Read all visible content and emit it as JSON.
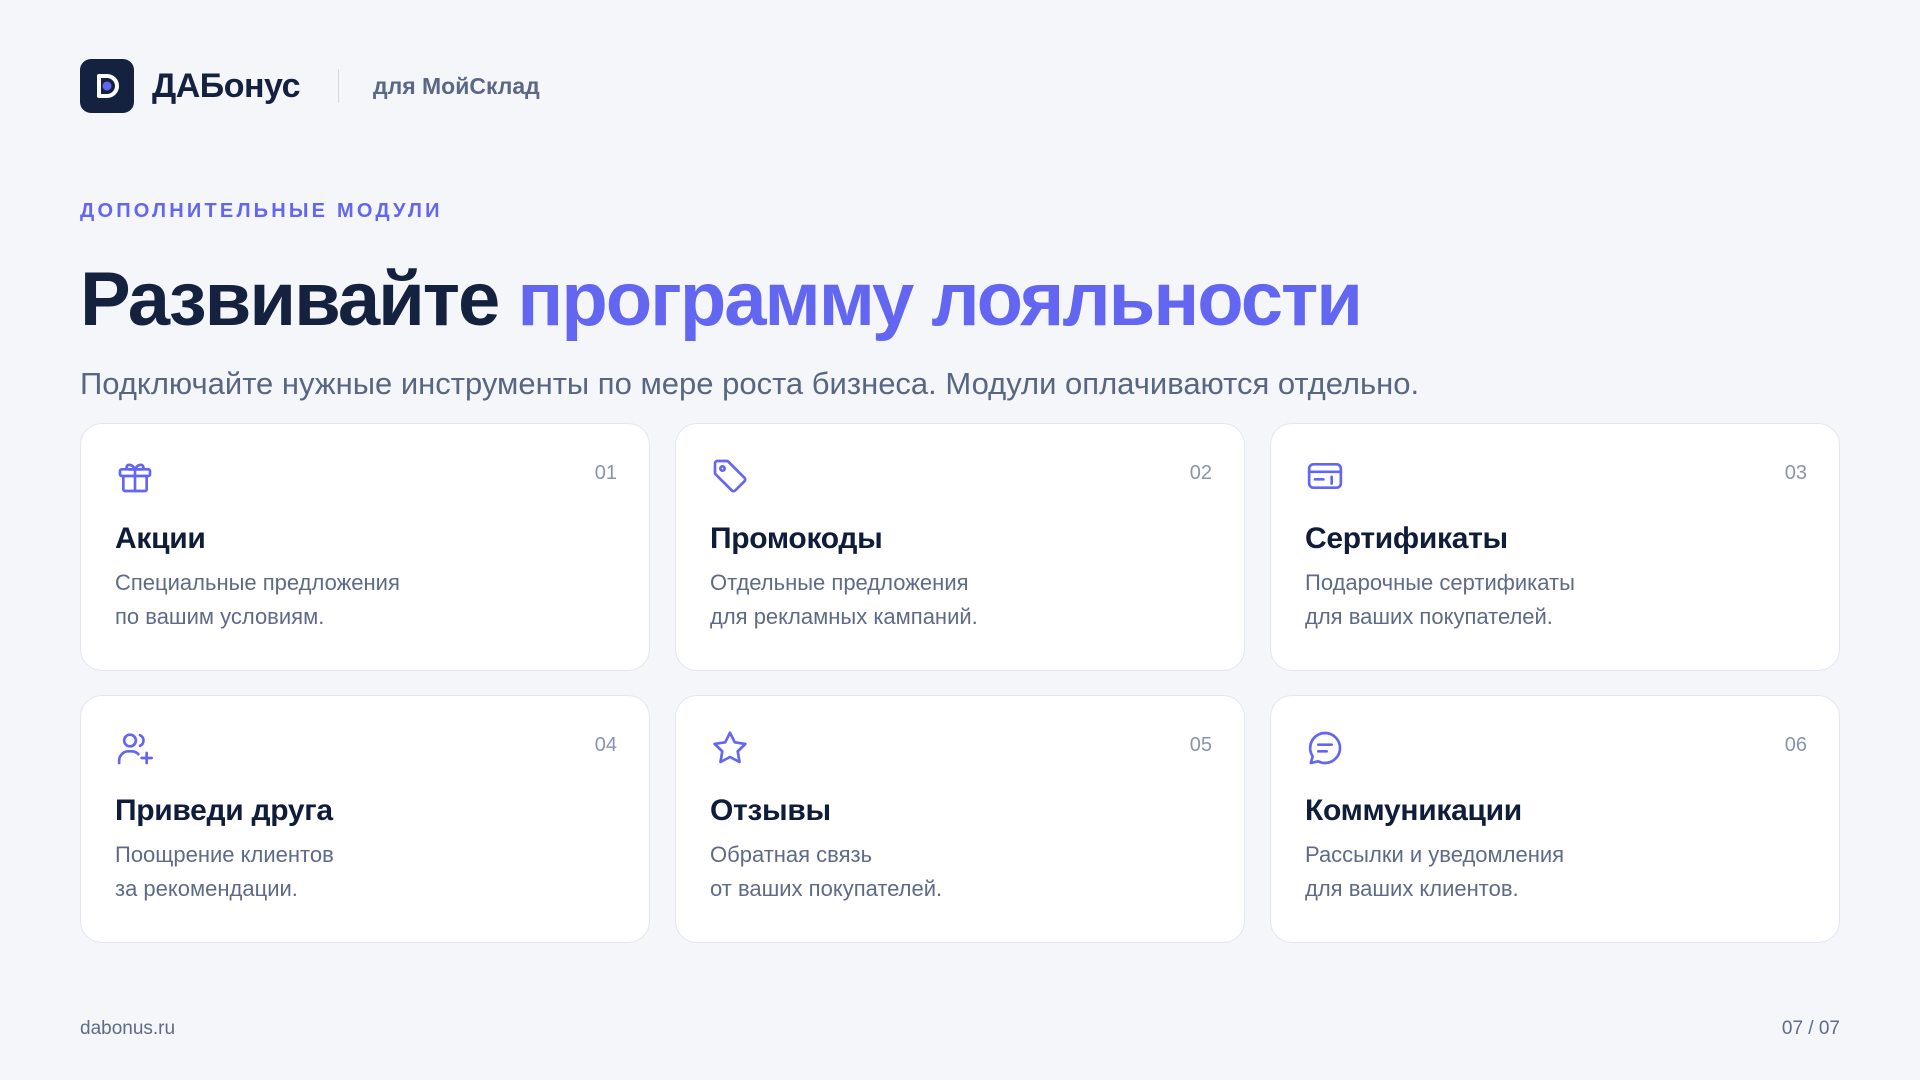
{
  "header": {
    "brand": "ДАБонус",
    "subtitle": "для МойСклад",
    "logo_icon": "dabonus-logo-icon"
  },
  "hero": {
    "eyebrow": "ДОПОЛНИТЕЛЬНЫЕ МОДУЛИ",
    "title_main": "Развивайте ",
    "title_accent": "программу лояльности",
    "subtitle": "Подключайте нужные инструменты по мере роста бизнеса. Модули оплачиваются отдельно."
  },
  "modules": [
    {
      "num": "01",
      "title": "Акции",
      "desc_line1": "Специальные предложения",
      "desc_line2": "по вашим условиям.",
      "icon": "gift-icon"
    },
    {
      "num": "02",
      "title": "Промокоды",
      "desc_line1": "Отдельные предложения",
      "desc_line2": "для рекламных кампаний.",
      "icon": "tag-icon"
    },
    {
      "num": "03",
      "title": "Сертификаты",
      "desc_line1": "Подарочные сертификаты",
      "desc_line2": "для ваших покупателей.",
      "icon": "gift-card-icon"
    },
    {
      "num": "04",
      "title": "Приведи друга",
      "desc_line1": "Поощрение клиентов",
      "desc_line2": "за рекомендации.",
      "icon": "users-plus-icon"
    },
    {
      "num": "05",
      "title": "Отзывы",
      "desc_line1": "Обратная связь",
      "desc_line2": "от ваших покупателей.",
      "icon": "star-icon"
    },
    {
      "num": "06",
      "title": "Коммуникации",
      "desc_line1": "Рассылки и уведомления",
      "desc_line2": "для ваших клиентов.",
      "icon": "chat-icon"
    }
  ],
  "footer": {
    "site": "dabonus.ru",
    "page": "07 / 07"
  },
  "colors": {
    "accent": "#6366f1",
    "navy": "#14223f",
    "background": "#f5f6fa"
  }
}
